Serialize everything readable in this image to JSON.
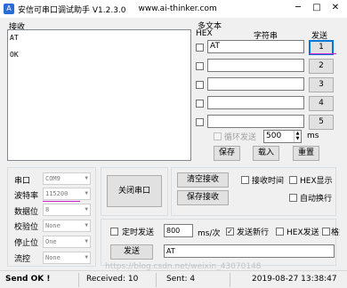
{
  "window": {
    "title": "安信可串口调试助手 V1.2.3.0",
    "url": "www.ai-thinker.com",
    "icon": "app-logo-icon",
    "minimize": "minimize-icon",
    "maximize": "maximize-icon",
    "close": "close-icon"
  },
  "receive": {
    "label": "接收",
    "lines": [
      "AT",
      "OK"
    ]
  },
  "multi": {
    "title": "多文本",
    "hex_header": "HEX",
    "string_header": "字符串",
    "send_header": "发送",
    "rows": [
      {
        "value": "AT",
        "button": "1"
      },
      {
        "value": "",
        "button": "2"
      },
      {
        "value": "",
        "button": "3"
      },
      {
        "value": "",
        "button": "4"
      },
      {
        "value": "",
        "button": "5"
      }
    ],
    "loop_label": "循环发送",
    "loop_value": "500",
    "loop_unit": "ms",
    "save_btn": "保存",
    "load_btn": "载入",
    "reset_btn": "重置"
  },
  "port": {
    "port_label": "串口",
    "port_value": "COM9",
    "baud_label": "波特率",
    "baud_value": "115200",
    "data_label": "数据位",
    "data_value": "8",
    "parity_label": "校验位",
    "parity_value": "None",
    "stop_label": "停止位",
    "stop_value": "One",
    "flow_label": "流控",
    "flow_value": "None",
    "close_btn": "关闭串口"
  },
  "recv_opts": {
    "clear_btn": "清空接收",
    "save_btn": "保存接收",
    "timestamp_label": "接收时间",
    "hex_display_label": "HEX显示",
    "auto_wrap_label": "自动换行"
  },
  "send_opts": {
    "timed_label": "定时发送",
    "interval_value": "800",
    "interval_unit": "ms/次",
    "newline_label": "发送新行",
    "hex_send_label": "HEX发送",
    "format_label": "格式输入",
    "send_btn": "发送",
    "send_value": "AT"
  },
  "status": {
    "state": "Send OK !",
    "received": "Received: 10",
    "sent": "Sent: 4",
    "datetime": "2019-08-27 13:38:47"
  },
  "watermark": "https://blog.csdn.net/weixin_43070148"
}
